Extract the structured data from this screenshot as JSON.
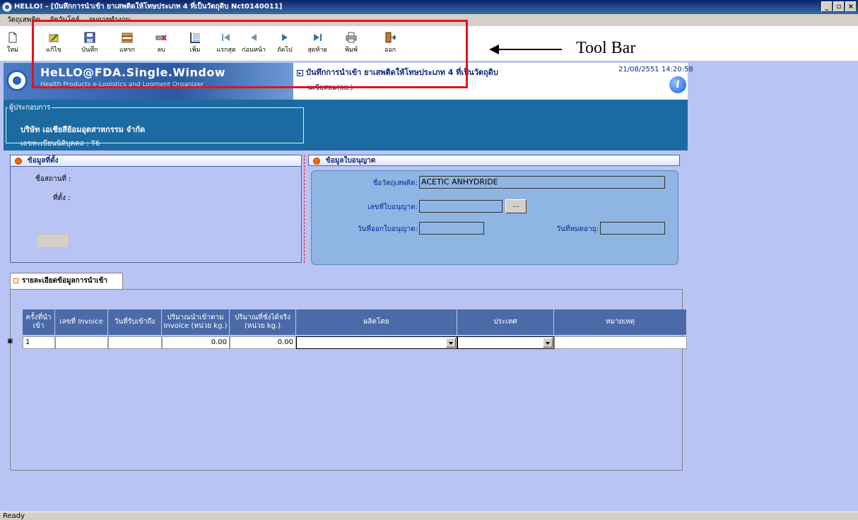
{
  "window": {
    "title": "HELLO! - [บันทึกการนำเข้า ยาเสพติดให้โทษประเภท 4 ที่เป็นวัตถุดิบ Nct0140011]",
    "minimize": "_",
    "restore": "▫",
    "close": "×"
  },
  "menubar": [
    "วัตถุเสพติด",
    "จัดวันโดร์",
    "จบการทำงาน"
  ],
  "toolbar": {
    "items": [
      {
        "name": "new",
        "label": "ใหม่",
        "icon": "new-doc-icon"
      },
      {
        "name": "edit",
        "label": "แก้ไข",
        "icon": "edit-icon"
      },
      {
        "name": "save",
        "label": "บันทึก",
        "icon": "save-icon"
      },
      {
        "name": "insert",
        "label": "แทรก",
        "icon": "insert-icon"
      },
      {
        "name": "delete",
        "label": "ลบ",
        "icon": "delete-icon"
      },
      {
        "name": "add",
        "label": "เพิ่ม",
        "icon": "add-row-icon"
      },
      {
        "name": "first",
        "label": "แรกสุด",
        "icon": "first-record-icon"
      },
      {
        "name": "previous",
        "label": "ก่อนหน้า",
        "icon": "previous-record-icon"
      },
      {
        "name": "next",
        "label": "ถัดไป",
        "icon": "next-record-icon"
      },
      {
        "name": "last",
        "label": "สุดท้าย",
        "icon": "last-record-icon"
      },
      {
        "name": "print",
        "label": "พิมพ์",
        "icon": "printer-icon"
      },
      {
        "name": "exit",
        "label": "ออก",
        "icon": "exit-icon"
      }
    ]
  },
  "annotation": {
    "label": "Tool Bar"
  },
  "banner": {
    "logo_text": "HeLLO@FDA.Single.Window",
    "logo_subtitle": "Health Products e-Logistics and Logment Organizer",
    "form_title": "บันทึกการนำเข้า ยาเสพติดให้โทษประเภท 4 ที่เป็นวัตถุดิบ",
    "form_subtitle": "นเขียสอม(อย.)",
    "datetime": "21/08/2551 14:20:58"
  },
  "operator": {
    "legend": "ผู้ประกอบการ",
    "company": "บริษัท เอเชียสีย้อมอุตสาหกรรม จำกัด",
    "registration": "เลขทะเบียนนิติบุคคล : T6"
  },
  "location_panel": {
    "title": "ข้อมูลที่ตั้ง",
    "premises_label": "ชื่อสถานที่ :",
    "address_label": "ที่ตั้ง :"
  },
  "license_panel": {
    "title": "ข้อมูลใบอนุญาต",
    "substance_label": "ชื่อวัตถุเสพติด:",
    "substance_value": "ACETIC ANHYDRIDE",
    "license_no_label": "เลขที่ใบอนุญาต:",
    "license_no_value": "",
    "browse_label": "...",
    "issue_date_label": "วันที่ออกใบอนุญาต:",
    "issue_date_value": "",
    "expire_date_label": "วันที่หมดอายุ:",
    "expire_date_value": ""
  },
  "import_tab": {
    "label": "รายละเอียดข้อมูลการนำเข้า",
    "columns": [
      "ครั้งที่นำเข้า",
      "เลขที่ Invoice",
      "วันที่รับเข้าถึง",
      "ปริมาณนำเข้าตาม Invoice (หน่วย kg.)",
      "ปริมาณที่ชั่งได้จริง (หน่วย kg.)",
      "ผลิตโดย",
      "ประเทศ",
      "หมายเหตุ"
    ],
    "rows": [
      {
        "no": "1",
        "invoice": "",
        "date": "",
        "qty_invoice": "0.00",
        "qty_actual": "0.00",
        "producer": "",
        "country": "",
        "remark": ""
      }
    ]
  },
  "status": "Ready",
  "colors": {
    "accent": "#1c6aa2",
    "annotation": "#e0141c",
    "background": "#b8c4f4"
  }
}
